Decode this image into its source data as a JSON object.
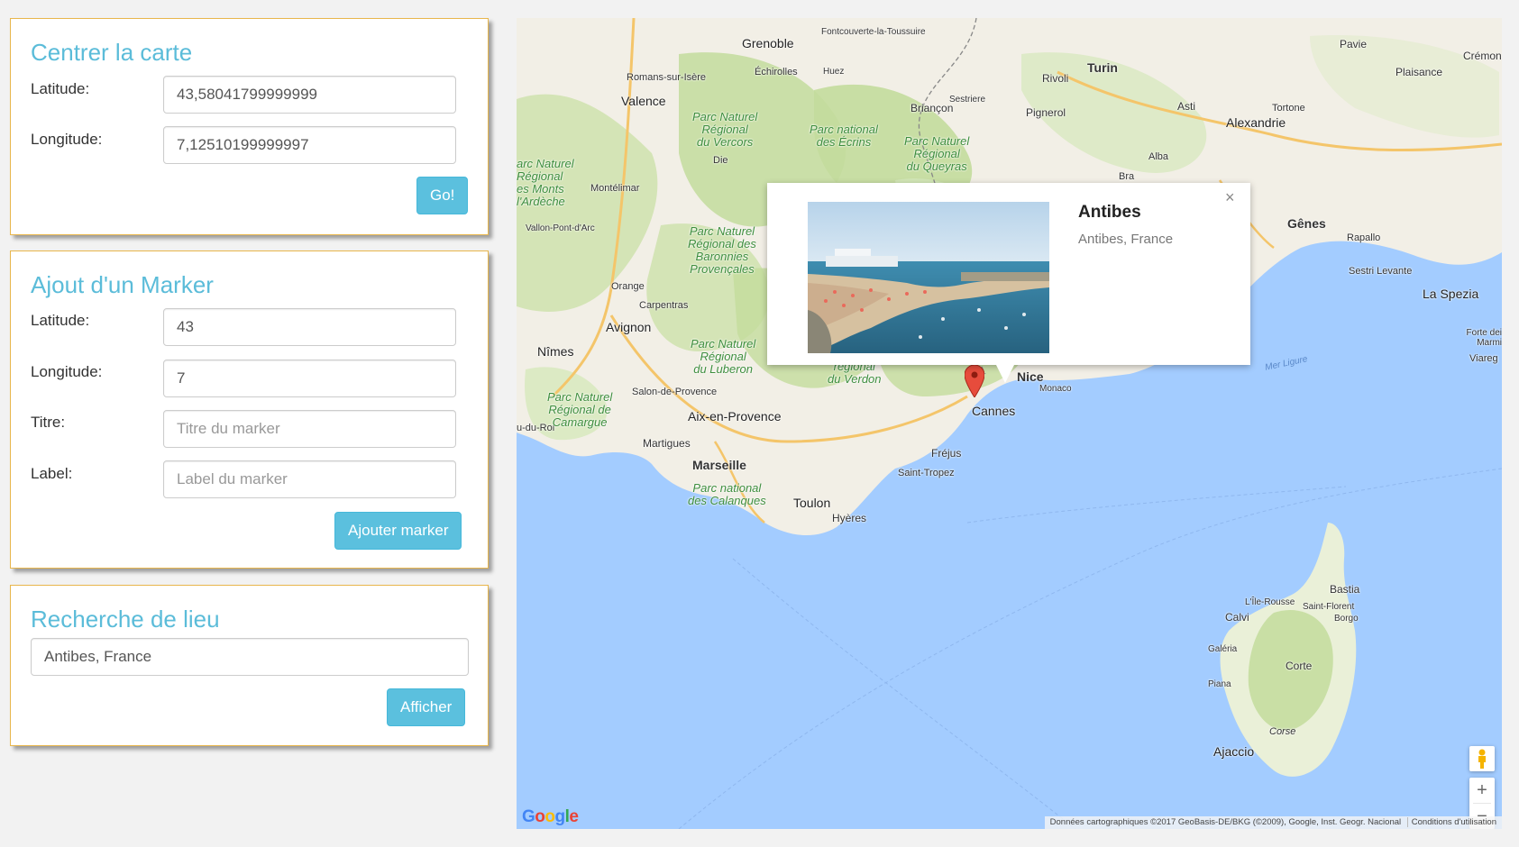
{
  "center_panel": {
    "title": "Centrer la carte",
    "latitude_label": "Latitude:",
    "latitude_value": "43,58041799999999",
    "longitude_label": "Longitude:",
    "longitude_value": "7,12510199999997",
    "go_label": "Go!"
  },
  "marker_panel": {
    "title": "Ajout d'un Marker",
    "latitude_label": "Latitude:",
    "latitude_value": "43",
    "longitude_label": "Longitude:",
    "longitude_value": "7",
    "titre_label": "Titre:",
    "titre_placeholder": "Titre du marker",
    "label_label": "Label:",
    "label_placeholder": "Label du marker",
    "add_label": "Ajouter marker"
  },
  "search_panel": {
    "title": "Recherche de lieu",
    "search_value": "Antibes, France",
    "show_label": "Afficher"
  },
  "infowindow": {
    "title": "Antibes",
    "subtitle": "Antibes, France",
    "close": "×"
  },
  "map": {
    "places": {
      "grenoble": "Grenoble",
      "fontcouverte": "Fontcouverte-la-Toussuire",
      "turin": "Turin",
      "pavie": "Pavie",
      "cremon": "Crémon",
      "plaisance": "Plaisance",
      "romans": "Romans-sur-Isère",
      "echirolles": "Échirolles",
      "huez": "Huez",
      "sestriere": "Sestriere",
      "rivoli": "Rivoli",
      "valence": "Valence",
      "briancon": "Briançon",
      "pinerolo": "Pignerol",
      "asti": "Asti",
      "tortone": "Tortone",
      "alexandrie": "Alexandrie",
      "die": "Die",
      "alba": "Alba",
      "bra": "Bra",
      "montelimar": "Montélimar",
      "vallon": "Vallon-Pont-d'Arc",
      "genes": "Gênes",
      "rapallo": "Rapallo",
      "sestri": "Sestri Levante",
      "laspezia": "La Spezia",
      "orange": "Orange",
      "carpentras": "Carpentras",
      "avignon": "Avignon",
      "nimes": "Nîmes",
      "salon": "Salon-de-Provence",
      "nice": "Nice",
      "monaco": "Monaco",
      "cannes": "Cannes",
      "aix": "Aix-en-Provence",
      "duroi": "u-du-Roi",
      "martigues": "Martigues",
      "frejus": "Fréjus",
      "marseille": "Marseille",
      "sttropez": "Saint-Tropez",
      "toulon": "Toulon",
      "hyeres": "Hyères",
      "fortedei": "Forte dei Marmi",
      "viareggio": "Viareg",
      "bastia": "Bastia",
      "ilerousse": "L'Île-Rousse",
      "stflorent": "Saint-Florent",
      "calvi": "Calvi",
      "borgo": "Borgo",
      "galeria": "Galéria",
      "corte": "Corte",
      "piana": "Piana",
      "corse": "Corse",
      "ajaccio": "Ajaccio"
    },
    "parks": {
      "vercors": "Parc Naturel\nRégional\ndu Vercors",
      "ecrins": "Parc national\ndes Écrins",
      "queyras": "Parc Naturel\nRégional\ndu Queyras",
      "ardeche": "arc Naturel\nRégional\nes Monts\nl'Ardèche",
      "baronnies": "Parc Naturel\nRégional des\nBaronnies\nProvençales",
      "luberon": "Parc Naturel\nRégional\ndu Luberon",
      "verdon": "régional\ndu Verdon",
      "camargue": "Parc Naturel\nRégional de\nCamargue",
      "calanques": "Parc national\ndes Calanques"
    },
    "sea_label": "Mer Ligure",
    "zoom_in": "+",
    "zoom_out": "−",
    "google_logo": "Google",
    "attribution": "Données cartographiques ©2017 GeoBasis-DE/BKG (©2009), Google, Inst. Geogr. Nacional",
    "terms": "Conditions d'utilisation"
  },
  "colors": {
    "accent": "#5bbcd9",
    "button": "#5bc0de",
    "panel_border": "#e8b64c",
    "sea": "#a3ccff",
    "land": "#f2efe6",
    "park": "#c5dea0",
    "marker": "#e74c3c"
  }
}
